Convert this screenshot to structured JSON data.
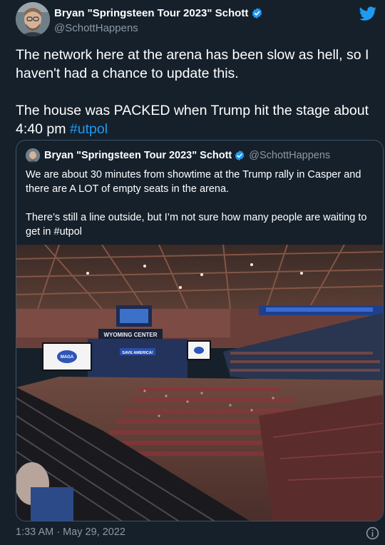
{
  "author": {
    "display_name": "Bryan \"Springsteen Tour 2023\" Schott",
    "handle": "@SchottHappens"
  },
  "tweet": {
    "paragraph1": "The network here at the arena has been slow as hell, so I haven't had a chance to update this.",
    "paragraph2_text": "The house was PACKED when Trump hit the stage about 4:40 pm ",
    "paragraph2_hashtag": "#utpol",
    "timestamp": "1:33 AM · May 29, 2022"
  },
  "quoted_tweet": {
    "display_name": "Bryan \"Springsteen Tour 2023\" Schott",
    "handle": "@SchottHappens",
    "paragraph1": "We are about 30 minutes from showtime at the Trump rally in Casper and there are A LOT of empty seats in the arena.",
    "paragraph2": "There’s still a line outside, but I’m not sure how many people are waiting to get in #utpol",
    "media": {
      "arena_sign": "WYOMING CENTER",
      "stage_banner": "SAVE AMERICA!",
      "screen_left": "MAGA",
      "ribbon": "SAVE AMERICA"
    }
  },
  "colors": {
    "background": "#15202b",
    "accent": "#1d9bf0",
    "secondary_text": "#8b98a5",
    "border": "#3d5466"
  },
  "icons": [
    "verified-badge-icon",
    "twitter-bird-icon",
    "info-icon"
  ]
}
